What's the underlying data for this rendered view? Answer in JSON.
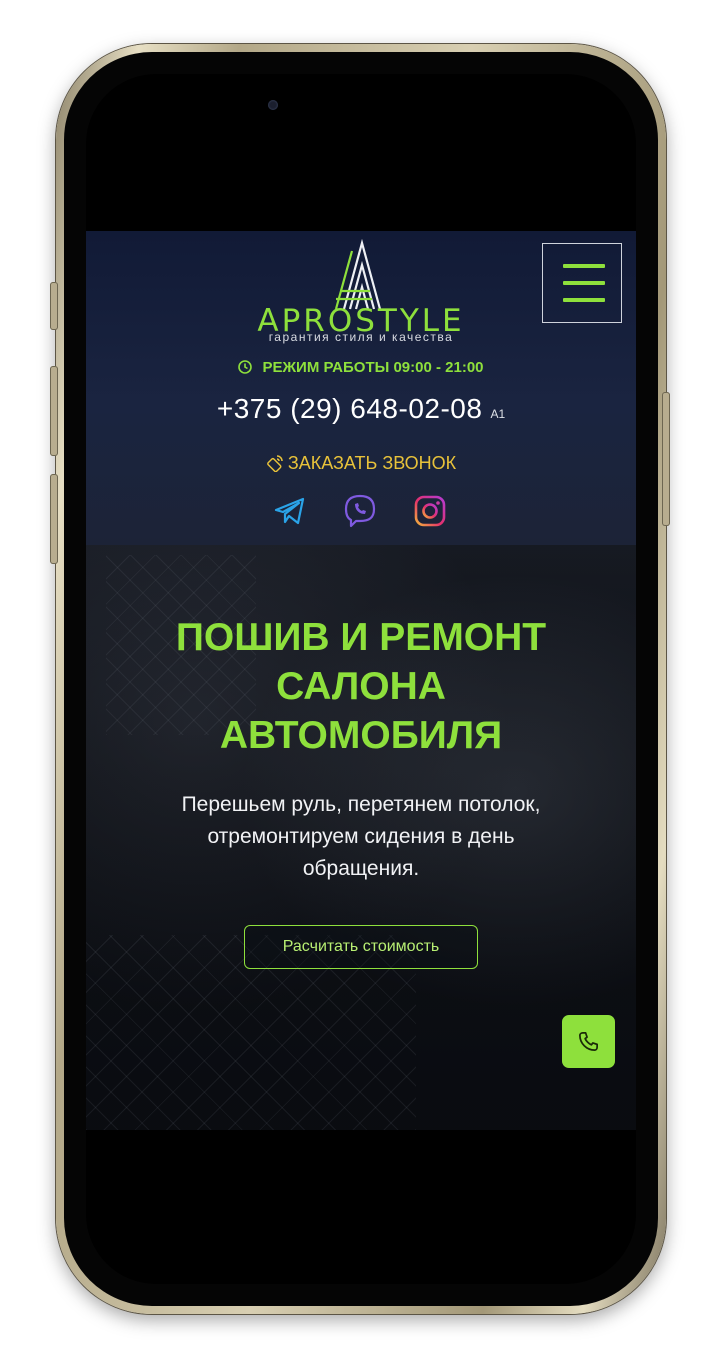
{
  "brand": {
    "name": "APROSTYLE",
    "tagline": "гарантия стиля и качества"
  },
  "header": {
    "hours": "РЕЖИМ РАБОТЫ 09:00 - 21:00",
    "phone": "+375 (29) 648-02-08",
    "carrier": "A1",
    "callback": "ЗАКАЗАТЬ ЗВОНОК",
    "social": [
      "telegram-icon",
      "viber-icon",
      "instagram-icon"
    ]
  },
  "hero": {
    "title_lines": [
      "ПОШИВ И РЕМОНТ",
      "САЛОНА",
      "АВТОМОБИЛЯ"
    ],
    "description_lines": [
      "Перешьем руль, перетянем потолок,",
      "отремонтируем сидения в день",
      "обращения."
    ],
    "cta": "Расчитать стоимость"
  },
  "colors": {
    "accent_green": "#8ee03c",
    "callback_yellow": "#e8c23a",
    "header_bg": "#1a2440"
  }
}
